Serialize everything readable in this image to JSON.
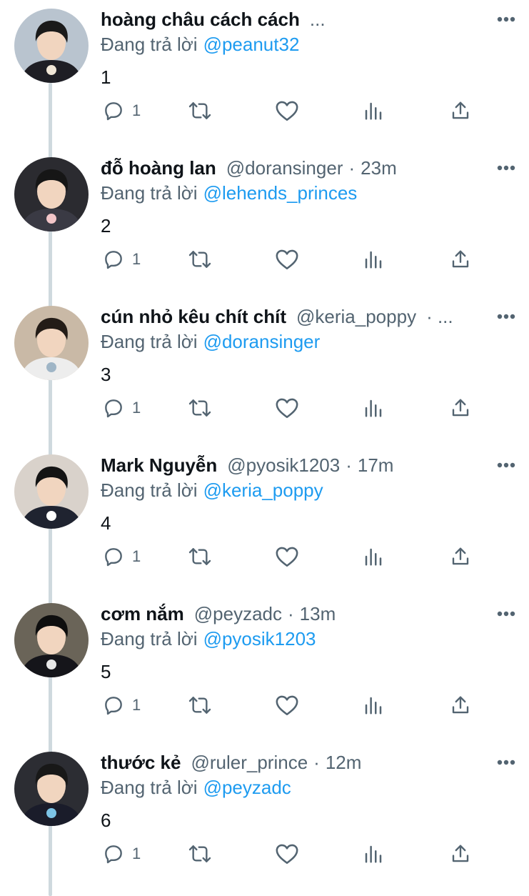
{
  "tweets": [
    {
      "name": "hoàng châu cách cách",
      "handle": "",
      "time": "",
      "overflow": "...",
      "reply_prefix": "Đang trả lời",
      "reply_to": "@peanut32",
      "text": "1",
      "reply_count": "1",
      "avatar": {
        "bg": "#b9c4cf",
        "shirt": "#1e1e24",
        "hair": "#1a1a1a",
        "accent": "#f0e6d6"
      }
    },
    {
      "name": "đỗ hoàng lan",
      "handle": "@doransinger",
      "time": "23m",
      "overflow": "",
      "reply_prefix": "Đang trả lời",
      "reply_to": "@lehends_princes",
      "text": "2",
      "reply_count": "1",
      "avatar": {
        "bg": "#2b2b30",
        "shirt": "#3a3a44",
        "hair": "#161616",
        "accent": "#f3c6c9"
      }
    },
    {
      "name": "cún nhỏ kêu chít chít",
      "handle": "@keria_poppy",
      "time": "",
      "overflow": "· ...",
      "reply_prefix": "Đang trả lời",
      "reply_to": "@doransinger",
      "text": "3",
      "reply_count": "1",
      "avatar": {
        "bg": "#c9b9a6",
        "shirt": "#ededed",
        "hair": "#231c17",
        "accent": "#9fb5c6"
      }
    },
    {
      "name": "Mark Nguyễn",
      "handle": "@pyosik1203",
      "time": "17m",
      "overflow": "",
      "reply_prefix": "Đang trả lời",
      "reply_to": "@keria_poppy",
      "text": "4",
      "reply_count": "1",
      "avatar": {
        "bg": "#d9d2cb",
        "shirt": "#1f2330",
        "hair": "#141414",
        "accent": "#ffffff"
      }
    },
    {
      "name": "cơm nắm",
      "handle": "@peyzadc",
      "time": "13m",
      "overflow": "",
      "reply_prefix": "Đang trả lời",
      "reply_to": "@pyosik1203",
      "text": "5",
      "reply_count": "1",
      "avatar": {
        "bg": "#6a6458",
        "shirt": "#15151a",
        "hair": "#0e0e0e",
        "accent": "#e8e8e8"
      }
    },
    {
      "name": "thước kẻ",
      "handle": "@ruler_prince",
      "time": "12m",
      "overflow": "",
      "reply_prefix": "Đang trả lời",
      "reply_to": "@peyzadc",
      "text": "6",
      "reply_count": "1",
      "avatar": {
        "bg": "#2c2d33",
        "shirt": "#1a1c2a",
        "hair": "#181818",
        "accent": "#7cc3e6"
      }
    }
  ],
  "icons": {
    "more": "more-horizontal-icon",
    "reply": "reply-bubble-icon",
    "retweet": "retweet-icon",
    "like": "heart-icon",
    "views": "views-bar-chart-icon",
    "share": "share-upload-icon"
  },
  "colors": {
    "link": "#1d9bf0",
    "secondary_text": "#536471",
    "primary_text": "#0f1419",
    "thread_line": "#cfd9de",
    "icon": "#536471"
  }
}
